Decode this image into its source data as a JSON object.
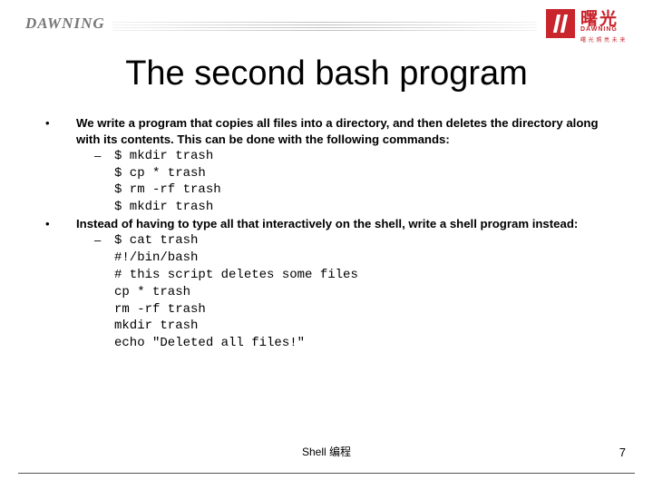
{
  "brand": {
    "left": "DAWNING",
    "right_cn": "曙光",
    "right_en": "DAWNING",
    "right_tag": "曙 光 照 亮 未 来"
  },
  "title": "The second bash program",
  "bullets": [
    {
      "text": "We write a program that copies all files into a directory, and then deletes the directory along with its contents. This can be done with the following commands:",
      "code": [
        "$ mkdir trash",
        "$ cp * trash",
        "$ rm -rf trash",
        "$ mkdir trash"
      ]
    },
    {
      "text": "Instead of having to type all that interactively on the shell, write a shell program instead:",
      "code": [
        "$ cat trash",
        "#!/bin/bash",
        "# this script deletes some files",
        "cp * trash",
        "rm -rf trash",
        "mkdir trash",
        "echo \"Deleted all files!\""
      ]
    }
  ],
  "footer": {
    "center": "Shell 编程",
    "page": "7"
  }
}
